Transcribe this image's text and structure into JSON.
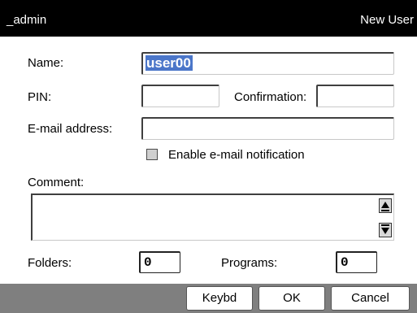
{
  "titlebar": {
    "left": "_admin",
    "right": "New User"
  },
  "form": {
    "name_label": "Name:",
    "name_value": "user00",
    "pin_label": "PIN:",
    "confirmation_label": "Confirmation:",
    "email_label": "E-mail address:",
    "notify_label": "Enable e-mail notification",
    "notify_checked": false,
    "comment_label": "Comment:",
    "folders_label": "Folders:",
    "folders_value": "0",
    "programs_label": "Programs:",
    "programs_value": "0"
  },
  "buttons": {
    "keybd": "Keybd",
    "ok": "OK",
    "cancel": "Cancel"
  },
  "icons": [
    "scroll-up-icon",
    "scroll-down-icon"
  ]
}
